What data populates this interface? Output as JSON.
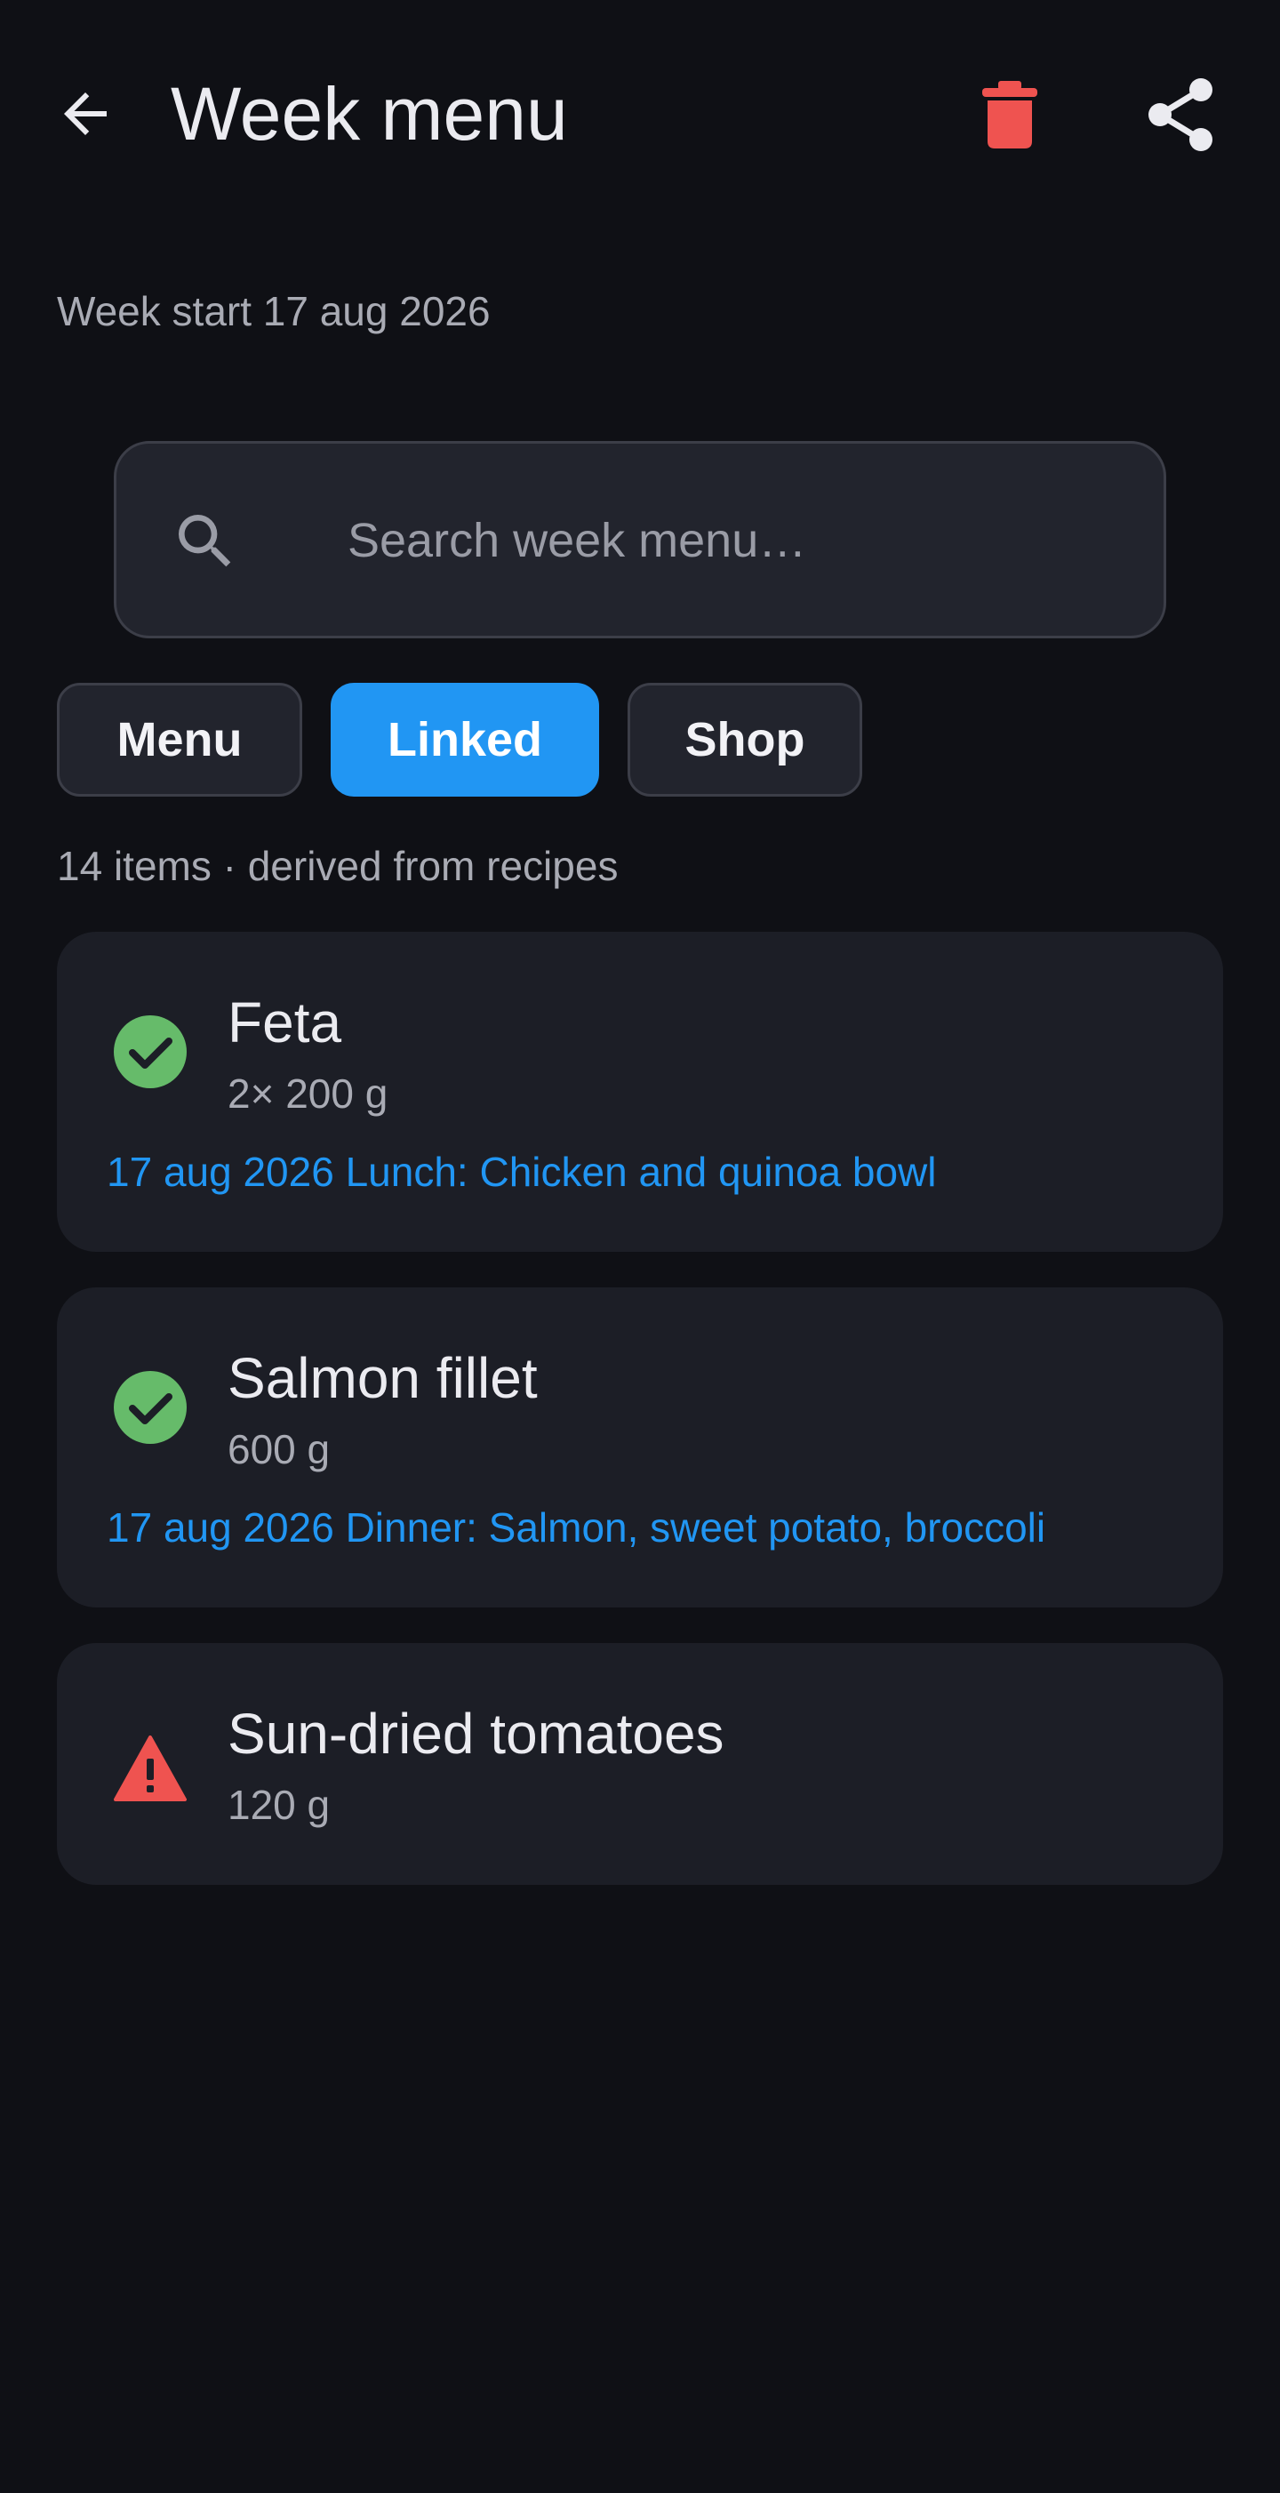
{
  "header": {
    "title": "Week menu",
    "back_icon": "arrow-left-icon",
    "delete_icon": "trash-icon",
    "share_icon": "share-icon",
    "delete_color": "#ef5350"
  },
  "week_start": "Week start 17 aug 2026",
  "search": {
    "placeholder": "Search week menu…",
    "value": ""
  },
  "tabs": [
    {
      "label": "Menu",
      "active": false
    },
    {
      "label": "Linked",
      "active": true
    },
    {
      "label": "Shop",
      "active": false
    }
  ],
  "items_summary": "14 items · derived from recipes",
  "items": [
    {
      "name": "Feta",
      "quantity": "2× 200 g",
      "status": "check-circle-icon",
      "link": "17 aug 2026 Lunch: Chicken and quinoa bowl"
    },
    {
      "name": "Salmon fillet",
      "quantity": "600 g",
      "status": "check-circle-icon",
      "link": "17 aug 2026 Dinner: Salmon, sweet potato, broccoli"
    },
    {
      "name": "Sun-dried tomatoes",
      "quantity": "120 g",
      "status": "warning-triangle-icon",
      "link": ""
    }
  ],
  "colors": {
    "accent": "#2196f3",
    "success": "#66bb6a",
    "warning": "#ef5350",
    "background": "#0f1015",
    "card": "#1c1e26"
  }
}
